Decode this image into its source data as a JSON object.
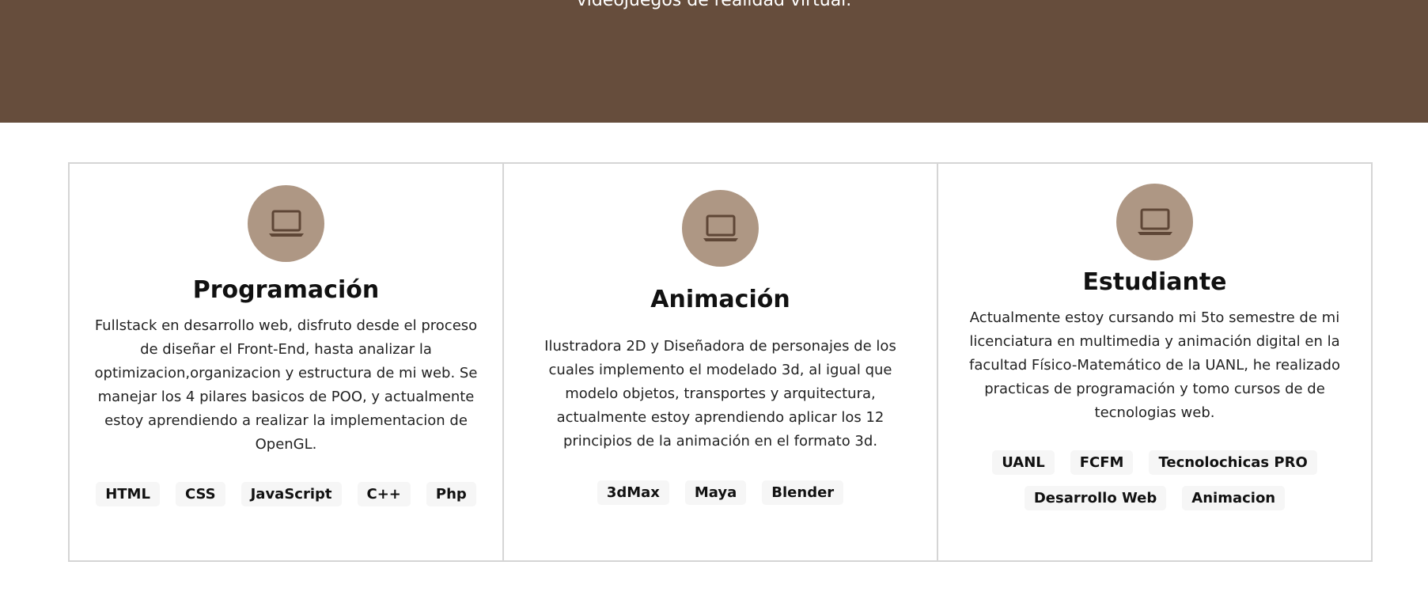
{
  "hero": {
    "text": "videojuegos de realidad virtual."
  },
  "cards": [
    {
      "title": "Programación",
      "description": "Fullstack en desarrollo web, disfruto desde el proceso de diseñar el Front-End, hasta analizar la optimizacion,organizacion y estructura de mi web. Se manejar los 4 pilares basicos de POO, y actualmente estoy aprendiendo a realizar la implementacion de OpenGL.",
      "icon": "laptop-icon",
      "tags": [
        "HTML",
        "CSS",
        "JavaScript",
        "C++",
        "Php"
      ]
    },
    {
      "title": "Animación",
      "description": "Ilustradora 2D y Diseñadora de personajes de los cuales implemento el modelado 3d, al igual que modelo objetos, transportes y arquitectura, actualmente estoy aprendiendo aplicar los 12 principios de la animación en el formato 3d.",
      "icon": "laptop-icon",
      "tags": [
        "3dMax",
        "Maya",
        "Blender"
      ]
    },
    {
      "title": "Estudiante",
      "description": "Actualmente estoy cursando mi 5to semestre de mi licenciatura en multimedia y animación digital en la facultad Físico-Matemático de la UANL, he realizado practicas de programación y tomo cursos de de tecnologias web.",
      "icon": "laptop-icon",
      "tags": [
        "UANL",
        "FCFM",
        "Tecnolochicas PRO",
        "Desarrollo Web",
        "Animacion"
      ]
    }
  ],
  "colors": {
    "hero_bg": "#664d3c",
    "icon_circle": "#ae9784",
    "icon_stroke": "#5e4636",
    "tag_bg": "#f6f6f6"
  }
}
